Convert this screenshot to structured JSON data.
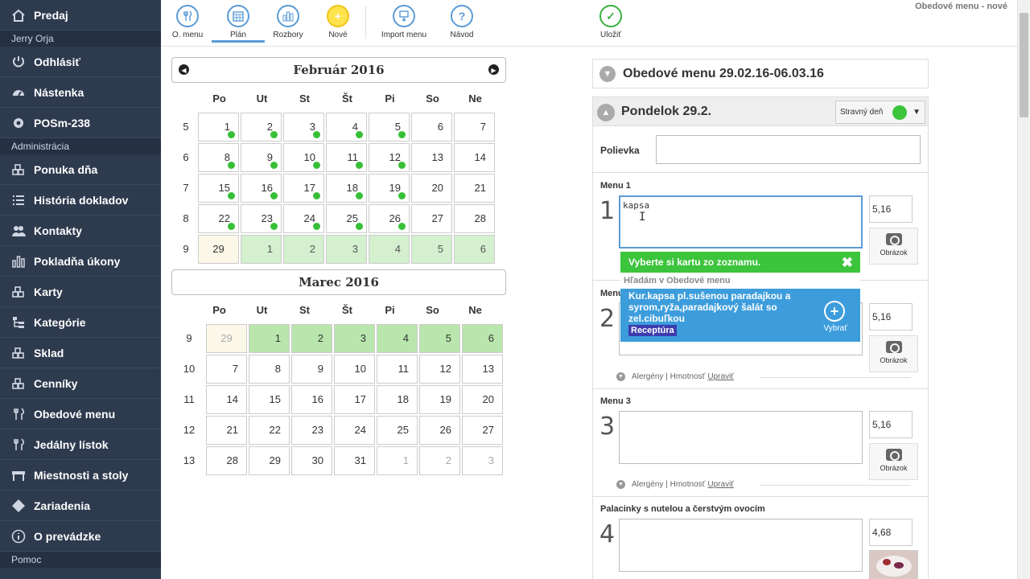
{
  "sidebar": {
    "items": [
      {
        "label": "Predaj",
        "icon": "home-icon"
      },
      {
        "head": "Jerry Orja"
      },
      {
        "label": "Odhlásiť",
        "icon": "power-icon"
      },
      {
        "label": "Nástenka",
        "icon": "dashboard-icon"
      },
      {
        "label": "POSm-238",
        "icon": "gear-icon"
      },
      {
        "head": "Administrácia"
      },
      {
        "label": "Ponuka dňa",
        "icon": "boxes-star-icon"
      },
      {
        "label": "História dokladov",
        "icon": "list-icon"
      },
      {
        "label": "Kontakty",
        "icon": "users-icon"
      },
      {
        "label": "Pokladňa úkony",
        "icon": "bar-chart-icon"
      },
      {
        "label": "Karty",
        "icon": "boxes-icon"
      },
      {
        "label": "Kategórie",
        "icon": "sitemap-icon"
      },
      {
        "label": "Sklad",
        "icon": "boxes-icon"
      },
      {
        "label": "Cenníky",
        "icon": "boxes-icon"
      },
      {
        "label": "Obedové menu",
        "icon": "cutlery-icon"
      },
      {
        "label": "Jedálny lístok",
        "icon": "cutlery-icon"
      },
      {
        "label": "Miestnosti a stoly",
        "icon": "table-icon"
      },
      {
        "label": "Zariadenia",
        "icon": "diamond-icon"
      },
      {
        "label": "O prevádzke",
        "icon": "info-icon"
      },
      {
        "head": "Pomoc"
      }
    ]
  },
  "toolbar": {
    "buttons": [
      {
        "label": "O. menu",
        "glyph": "✕",
        "icon": "cutlery-icon"
      },
      {
        "label": "Plán",
        "glyph": "▦",
        "icon": "calendar-icon"
      },
      {
        "label": "Rozbory",
        "glyph": "▮",
        "icon": "bar-chart-icon"
      },
      {
        "label": "Nové",
        "glyph": "+",
        "icon": "plus-icon"
      },
      {
        "label": "Import menu",
        "glyph": "⇪",
        "icon": "import-icon"
      },
      {
        "label": "Návod",
        "glyph": "?",
        "icon": "help-icon"
      },
      {
        "label": "Uložiť",
        "glyph": "✓",
        "icon": "check-icon"
      }
    ],
    "top_right": "Obedové menu - nové"
  },
  "calendar1": {
    "title": "Február 2016",
    "dows": [
      "Po",
      "Ut",
      "St",
      "Št",
      "Pi",
      "So",
      "Ne"
    ],
    "weeks": [
      {
        "wk": "5",
        "days": [
          [
            "1",
            "d"
          ],
          [
            "2",
            "d"
          ],
          [
            "3",
            "d"
          ],
          [
            "4",
            "d"
          ],
          [
            "5",
            "d"
          ],
          [
            "6",
            ""
          ],
          [
            "7",
            ""
          ]
        ]
      },
      {
        "wk": "6",
        "days": [
          [
            "8",
            "d"
          ],
          [
            "9",
            "d"
          ],
          [
            "10",
            "d"
          ],
          [
            "11",
            "d"
          ],
          [
            "12",
            "d"
          ],
          [
            "13",
            ""
          ],
          [
            "14",
            ""
          ]
        ]
      },
      {
        "wk": "7",
        "days": [
          [
            "15",
            "d"
          ],
          [
            "16",
            "d"
          ],
          [
            "17",
            "d"
          ],
          [
            "18",
            "d"
          ],
          [
            "19",
            "d"
          ],
          [
            "20",
            ""
          ],
          [
            "21",
            ""
          ]
        ]
      },
      {
        "wk": "8",
        "days": [
          [
            "22",
            "d"
          ],
          [
            "23",
            "d"
          ],
          [
            "24",
            "d"
          ],
          [
            "25",
            "d"
          ],
          [
            "26",
            "d"
          ],
          [
            "27",
            ""
          ],
          [
            "28",
            ""
          ]
        ]
      },
      {
        "wk": "9",
        "days": [
          [
            "29",
            "t"
          ],
          [
            "1",
            "g"
          ],
          [
            "2",
            "g"
          ],
          [
            "3",
            "g"
          ],
          [
            "4",
            "g"
          ],
          [
            "5",
            "g"
          ],
          [
            "6",
            "g"
          ]
        ]
      }
    ]
  },
  "calendar2": {
    "title": "Marec 2016",
    "dows": [
      "Po",
      "Ut",
      "St",
      "Št",
      "Pi",
      "So",
      "Ne"
    ],
    "weeks": [
      {
        "wk": "9",
        "days": [
          [
            "29",
            "to"
          ],
          [
            "1",
            "G"
          ],
          [
            "2",
            "G"
          ],
          [
            "3",
            "G"
          ],
          [
            "4",
            "G"
          ],
          [
            "5",
            "G"
          ],
          [
            "6",
            "G"
          ]
        ]
      },
      {
        "wk": "10",
        "days": [
          [
            "7",
            ""
          ],
          [
            "8",
            ""
          ],
          [
            "9",
            ""
          ],
          [
            "10",
            ""
          ],
          [
            "11",
            ""
          ],
          [
            "12",
            ""
          ],
          [
            "13",
            ""
          ]
        ]
      },
      {
        "wk": "11",
        "days": [
          [
            "14",
            ""
          ],
          [
            "15",
            ""
          ],
          [
            "16",
            ""
          ],
          [
            "17",
            ""
          ],
          [
            "18",
            ""
          ],
          [
            "19",
            ""
          ],
          [
            "20",
            ""
          ]
        ]
      },
      {
        "wk": "12",
        "days": [
          [
            "21",
            ""
          ],
          [
            "22",
            ""
          ],
          [
            "23",
            ""
          ],
          [
            "24",
            ""
          ],
          [
            "25",
            ""
          ],
          [
            "26",
            ""
          ],
          [
            "27",
            ""
          ]
        ]
      },
      {
        "wk": "13",
        "days": [
          [
            "28",
            ""
          ],
          [
            "29",
            ""
          ],
          [
            "30",
            ""
          ],
          [
            "31",
            ""
          ],
          [
            "1",
            "o"
          ],
          [
            "2",
            "o"
          ],
          [
            "3",
            "o"
          ]
        ]
      }
    ]
  },
  "menu_panel": {
    "title": "Obedové menu 29.02.16-06.03.16",
    "day_title": "Pondelok 29.2.",
    "day_type": "Stravný deň",
    "soup_label": "Polievka",
    "menu1_label": "Menu 1",
    "menu1_num": "1",
    "menu1_value": "kapsa",
    "menu1_price": "5,16",
    "menu2_label": "Menu 2",
    "menu2_label_visible": "Menu",
    "menu2_num": "2",
    "menu2_price": "5,16",
    "menu3_label": "Menu 3",
    "menu3_num": "3",
    "menu3_price": "5,16",
    "menu4_label": "Palacinky s nutelou a čerstvým ovocím",
    "menu4_num": "4",
    "menu4_price": "4,68",
    "photo_label": "Obrázok",
    "alergeny": "Alergény | Hmotnosť",
    "upravit": "Upraviť"
  },
  "dropdown": {
    "header": "Vyberte si kartu zo zoznamu.",
    "searching": "Hľadám v Obedové menu",
    "item_text": "Kur.kapsa pl.sušenou paradajkou a syrom,ryža,paradajkový šalát so zel.cibuľkou",
    "item_tag": "Receptúra",
    "item_action": "Vybrať"
  },
  "colors": {
    "sidebar": "#2e3a4e",
    "accent": "#5b9bd5",
    "green": "#3cc43c",
    "blue": "#3d9ddc",
    "tag": "#3c3cae"
  }
}
